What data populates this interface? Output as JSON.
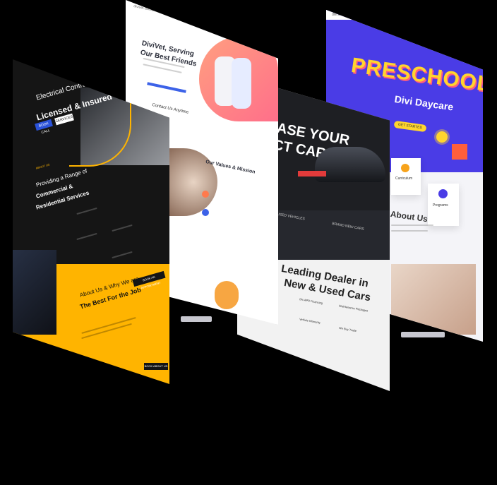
{
  "electrical": {
    "nav_brand": "",
    "hero_line1": "Electrical Contractor",
    "hero_line2": "Licensed & Insured",
    "btn_primary": "BOOK CALL",
    "btn_secondary": "SERVICES",
    "eyebrow": "ABOUT US",
    "services_line1": "Providing a Range of",
    "services_line2": "Commercial &",
    "services_line3": "Residential Services",
    "about_line1": "About Us & Why We are",
    "about_line2": "The Best For the Job",
    "cta": "BOOK AN APPOINTMENT",
    "footer_cta": "BOOK ABOUT US",
    "colors": {
      "accent": "#ffb400",
      "dark": "#151515",
      "blue": "#2a52d9"
    }
  },
  "vet": {
    "nav_brand": "divivet.com/cms/landing",
    "hero_line1": "DiviVet, Serving",
    "hero_line2": "Our Best Friends",
    "contact": "Contact Us Anytime",
    "values_title": "Our Values & Mission",
    "colors": {
      "accent": "#ff7a4d",
      "blue": "#3c62e8"
    }
  },
  "cars": {
    "hero_line1": "HASE YOUR",
    "hero_line2": "ECT CAR",
    "label_used": "USED VEHICLES",
    "label_new": "BRAND NEW CARS",
    "dealer_line1": "Leading Dealer in",
    "dealer_line2": "New & Used Cars",
    "feature1": "0% APR Financing",
    "feature2": "Maintenance Packages",
    "feature3": "Vehicle Warranty",
    "feature4": "We Buy Trade",
    "colors": {
      "accent": "#e23b3b",
      "dark": "#24262b"
    }
  },
  "preschool": {
    "nav_brand": "divi.cms.landing",
    "title": "PRESCHOOL",
    "subtitle": "Divi Daycare",
    "btn": "GET STARTED",
    "card1": "Curriculum",
    "card2": "Programs",
    "about": "About Us",
    "colors": {
      "bg": "#4a3ce6",
      "yellow": "#ffd52e"
    }
  }
}
